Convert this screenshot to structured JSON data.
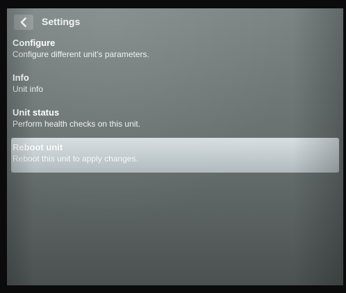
{
  "header": {
    "title": "Settings",
    "back_icon": "chevron-left-icon"
  },
  "menu": {
    "items": [
      {
        "title": "Configure",
        "description": "Configure different unit's parameters.",
        "selected": false
      },
      {
        "title": "Info",
        "description": "Unit info",
        "selected": false
      },
      {
        "title": "Unit status",
        "description": "Perform health checks on this unit.",
        "selected": false
      },
      {
        "title": "Reboot unit",
        "description": "Reboot this unit to apply changes.",
        "selected": true
      }
    ]
  },
  "colors": {
    "screen_background": "#6f7877",
    "selected_highlight": "#d8e0e3",
    "text": "#ffffff"
  }
}
